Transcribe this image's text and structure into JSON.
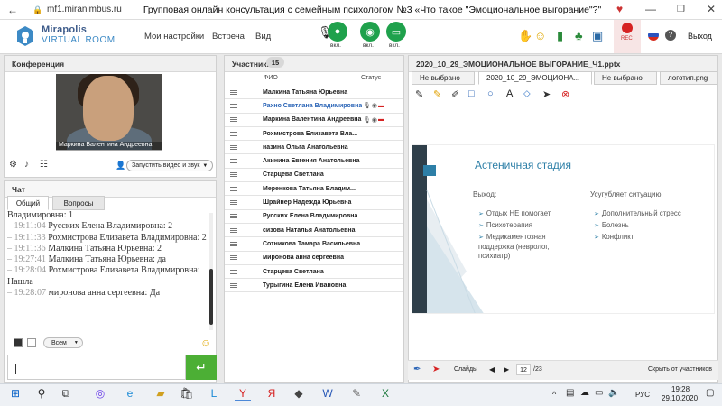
{
  "browser": {
    "url": "mf1.miranimbus.ru",
    "title": "Групповая онлайн консультация с семейным психологом №3 «Что такое \"Эмоциональное выгорание\"?\""
  },
  "header": {
    "logo_line1": "Mirapolis",
    "logo_line2": "VIRTUAL ROOM",
    "menu": [
      "Мои настройки",
      "Встреча",
      "Вид"
    ],
    "media": [
      {
        "label": "вкл.",
        "icon": "microphone-icon"
      },
      {
        "label": "вкл.",
        "icon": "webcam-icon"
      },
      {
        "label": "вкл.",
        "icon": "screen-share-icon"
      }
    ],
    "rec_label": "REC",
    "exit_label": "Выход"
  },
  "conference": {
    "title": "Конференция",
    "video_name": "Маркина Валентина  Андреевна",
    "video_button": "Запустить видео и звук"
  },
  "chat": {
    "title": "Чат",
    "tabs": [
      "Общий",
      "Вопросы"
    ],
    "messages": [
      {
        "time": "",
        "text": "Владимировна: 1"
      },
      {
        "time": "19:11:04",
        "text": "Русских Елена Владимировна: 2"
      },
      {
        "time": "19:11:33",
        "text": "Рохмистрова  Елизавета Владимировна: 2"
      },
      {
        "time": "19:11:36",
        "text": "Малкина Татьяна  Юрьевна: 2"
      },
      {
        "time": "19:27:41",
        "text": "Малкина Татьяна  Юрьевна: да"
      },
      {
        "time": "19:28:04",
        "text": "Рохмистрова  Елизавета Владимировна: Нашла"
      },
      {
        "time": "19:28:07",
        "text": "миронова  анна  сергеевна: Да"
      }
    ],
    "recipient": "Всем"
  },
  "participants": {
    "title": "Участники",
    "count": "15",
    "col_name": "ФИО",
    "col_status": "Статус",
    "rows": [
      {
        "name": "Малкина Татьяна  Юрьевна",
        "highlight": false,
        "status": ""
      },
      {
        "name": "Рахно Светлана  Владимировна",
        "highlight": true,
        "status": "presenter"
      },
      {
        "name": "Маркина Валентина  Андреевна",
        "highlight": false,
        "status": "presenter"
      },
      {
        "name": "Рохмистрова  Елизавета Вла...",
        "highlight": false,
        "status": ""
      },
      {
        "name": "назина  Ольга  Анатольевна",
        "highlight": false,
        "status": ""
      },
      {
        "name": "Акинина  Евгения  Анатольевна",
        "highlight": false,
        "status": ""
      },
      {
        "name": "Старцева  Светлана",
        "highlight": false,
        "status": ""
      },
      {
        "name": "Меренкова  Татьяна  Владим...",
        "highlight": false,
        "status": ""
      },
      {
        "name": "Шрайнер Надежда  Юрьевна",
        "highlight": false,
        "status": ""
      },
      {
        "name": "Русских Елена Владимировна",
        "highlight": false,
        "status": ""
      },
      {
        "name": "сизова  Наталья  Анатольевна",
        "highlight": false,
        "status": ""
      },
      {
        "name": "Сотникова  Тамара Васильевна",
        "highlight": false,
        "status": ""
      },
      {
        "name": "миронова  анна  сергеевна",
        "highlight": false,
        "status": ""
      },
      {
        "name": "Старцева Светлана",
        "highlight": false,
        "status": ""
      },
      {
        "name": "Турыгина  Елена  Ивановна",
        "highlight": false,
        "status": ""
      }
    ]
  },
  "presentation": {
    "title": "2020_10_29_ЭМОЦИОНАЛЬНОЕ ВЫГОРАНИЕ_Ч1.pptx",
    "tabs": [
      "Не выбрано",
      "2020_10_29_ЭМОЦИОНА...",
      "Не выбрано",
      "логотип.png"
    ],
    "slide": {
      "title": "Астеничная стадия",
      "left_head": "Выход:",
      "left_bullets": [
        "Отдых НЕ помогает",
        "Психотерапия",
        "Медикаментозная поддержка (невролог, психиатр)"
      ],
      "right_head": "Усугубляет ситуацию:",
      "right_bullets": [
        "Дополнительный стресс",
        "Болезнь",
        "Конфликт"
      ]
    },
    "slides_label": "Слайды",
    "page_current": "12",
    "page_total": "/23",
    "hide_label": "Скрыть от участников"
  },
  "taskbar": {
    "lang": "РУС",
    "time": "19:28",
    "date": "29.10.2020"
  }
}
